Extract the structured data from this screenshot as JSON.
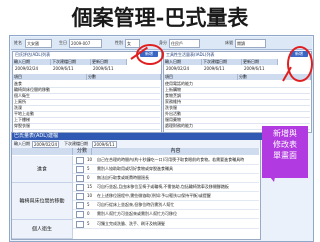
{
  "title": "個案管理-巴式量表",
  "top_bar": {
    "fields": [
      {
        "label": "姓名",
        "value": "大安國"
      },
      {
        "label": "生日",
        "value": "2009-007"
      },
      {
        "label": "性別",
        "value": "女"
      },
      {
        "label": "身分",
        "value": "住民戶"
      },
      {
        "label": "床號",
        "value": "閱讀"
      }
    ],
    "button": "查詢"
  },
  "left_panel": {
    "title": "巴氏評估(ADL)列表",
    "add_button": "新增",
    "columns": [
      "輸入日期",
      "下次建檔日期",
      "更新日期"
    ],
    "row": [
      "2009/02/24",
      "2009/6/11",
      "2009/6/11"
    ],
    "sub_columns": [
      "項目",
      "分數"
    ],
    "items": [
      "進食",
      "輪椅與床位間的移動",
      "個人衛生",
      "上廁所",
      "洗澡",
      "平地上走動",
      "上下樓梯",
      "穿脫衣服",
      "大便控制"
    ]
  },
  "right_panel": {
    "title": "工具性生活量表(IADL)列表",
    "add_button": "新增",
    "columns": [
      "輸入日期",
      "下次建檔日期",
      "更新日期"
    ],
    "row": [
      "2009/02/24",
      "2009/6/11",
      "2009/6/11"
    ],
    "sub_columns": [
      "項目",
      "分數"
    ],
    "items": [
      "使用電話的能力",
      "上街購物",
      "食物烹調",
      "家務維持",
      "洗衣服",
      "外出活動",
      "服用藥物",
      "處理財務的能力"
    ]
  },
  "callout": {
    "line1": "新增與",
    "line2": "修改表",
    "line3": "單畫面"
  },
  "form": {
    "title": "巴氏量表(ADL)建檔",
    "sub_label_date": "輸入日期",
    "sub_date": "2009/02/24",
    "sub_label_next": "下次建檔日期",
    "sub_next": "2009/6/11",
    "columns": [
      "",
      "分數",
      "內容"
    ],
    "categories": [
      {
        "name": "進食",
        "items": [
          {
            "score": "10",
            "text": "自己在合理的時間內(約十秒鐘吃一口)可用筷子取食眼前的食物。若需要進食輔具時"
          },
          {
            "score": "5",
            "text": "需別人協助取用或切好食物或穿脫進食輔具"
          },
          {
            "score": "0",
            "text": "無法自行取食或耗費時間過長"
          }
        ]
      },
      {
        "name": "輪椅與床位間的移動",
        "items": [
          {
            "score": "15",
            "text": "可自行坐起,且由床移位至椅子或輪椅,不需協助,包括輪椅煞車及移開腳踏板"
          },
          {
            "score": "10",
            "text": "在上述移位過程中,需些微協助(例如:予以輕扶以保持平衡)或提醒"
          },
          {
            "score": "5",
            "text": "可自行從床上坐起來,但移位時仍需別人幫忙"
          },
          {
            "score": "0",
            "text": "需別人幫忙方可坐起來或需別人幫忙方可移位"
          }
        ]
      },
      {
        "name": "個人衛生",
        "items": [
          {
            "score": "5",
            "text": "可獨立完成洗臉、洗手、刷牙及梳頭髮"
          }
        ]
      }
    ]
  }
}
